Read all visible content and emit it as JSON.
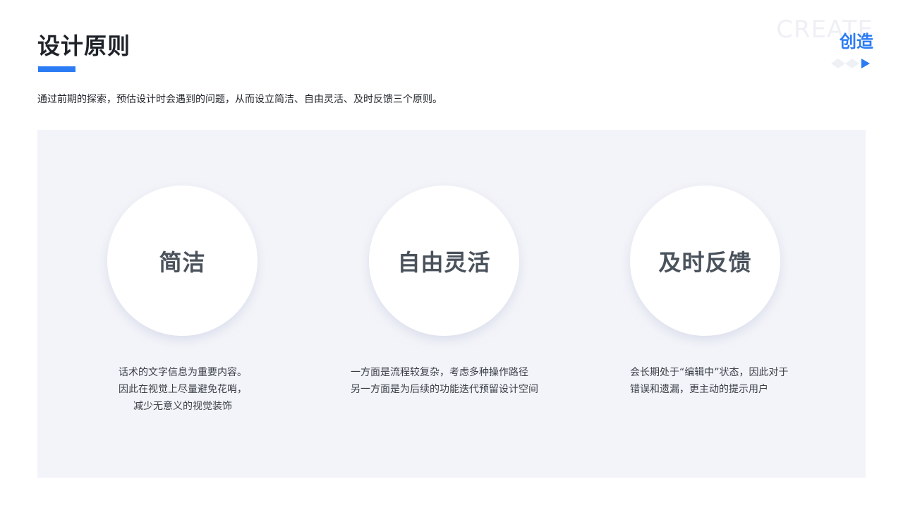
{
  "header": {
    "title": "设计原则",
    "intro": "通过前期的探索，预估设计时会遇到的问题，从而设立简洁、自由灵活、及时反馈三个原则。"
  },
  "brand": {
    "watermark": "CREATE",
    "label": "创造",
    "accent_color": "#2b7cf4"
  },
  "principles": [
    {
      "title": "简洁",
      "lines": [
        "话术的文字信息为重要内容。",
        "因此在视觉上尽量避免花哨，",
        "减少无意义的视觉装饰"
      ]
    },
    {
      "title": "自由灵活",
      "lines": [
        "一方面是流程较复杂，考虑多种操作路径",
        "另一方面是为后续的功能迭代预留设计空间"
      ]
    },
    {
      "title": "及时反馈",
      "lines": [
        "会长期处于“编辑中”状态，因此对于",
        "错误和遗漏，更主动的提示用户"
      ]
    }
  ]
}
